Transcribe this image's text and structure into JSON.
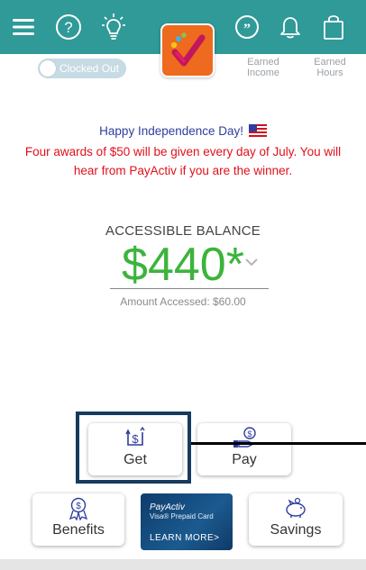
{
  "header": {
    "icons": [
      "menu-icon",
      "help-icon",
      "lightbulb-icon",
      "chat-quote-icon",
      "bell-icon",
      "shopping-bag-icon"
    ],
    "clock_status": "Clocked Out",
    "earned_income": [
      "Earned",
      "Income"
    ],
    "earned_hours": [
      "Earned",
      "Hours"
    ]
  },
  "announcement": {
    "title": "Happy Independence Day!",
    "line1": "Four awards of $50 will be given every day of July. You will",
    "line2": "hear from PayActiv if you are the winner."
  },
  "balance": {
    "label": "ACCESSIBLE BALANCE",
    "amount": "$440*",
    "accessed": "Amount Accessed: $60.00"
  },
  "actions": {
    "get": "Get",
    "pay": "Pay",
    "benefits": "Benefits",
    "savings": "Savings"
  },
  "promo": {
    "brand": "PayActiv",
    "subtitle": "Visa® Prepaid Card",
    "cta": "LEARN MORE>"
  },
  "colors": {
    "header_bg": "#2f9a98",
    "logo_bg": "#ee6a1f",
    "balance_green": "#3cb43c",
    "announcement_red": "#e0101b",
    "announcement_blue": "#2f3d9f",
    "highlight_border": "#173a5e"
  }
}
